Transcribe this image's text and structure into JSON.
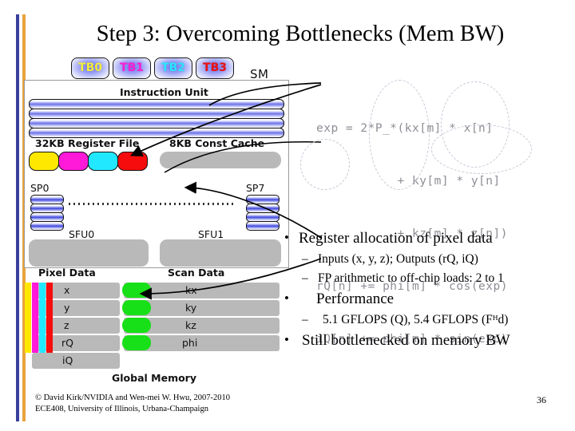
{
  "slide": {
    "title": "Step 3: Overcoming Bottlenecks (Mem BW)"
  },
  "diagram": {
    "sm_label": "SM",
    "thread_blocks": [
      {
        "label": "TB0",
        "color": "#f5ef3a"
      },
      {
        "label": "TB1",
        "color": "#ff1fd8"
      },
      {
        "label": "TB2",
        "color": "#2ae6ff"
      },
      {
        "label": "TB3",
        "color": "#ee1212"
      }
    ],
    "instruction_unit_label": "Instruction Unit",
    "register_file_label": "32KB Register File",
    "const_cache_label": "8KB Const Cache",
    "register_colors": [
      "#ffe800",
      "#ff19d8",
      "#22e8ff",
      "#f60c0c"
    ],
    "sp_left_label": "SP0",
    "sp_right_label": "SP7",
    "sfu0_label": "SFU0",
    "sfu1_label": "SFU1",
    "pixel_data_label": "Pixel Data",
    "scan_data_label": "Scan Data",
    "global_memory_label": "Global Memory",
    "pixel_data_rows": [
      "x",
      "y",
      "z",
      "rQ",
      "iQ"
    ],
    "scan_data_rows": [
      "kx",
      "ky",
      "kz",
      "phi"
    ]
  },
  "code": {
    "lines": [
      "exp = 2*P_*(kx[m] * x[n]",
      "           + ky[m] * y[n]",
      "           + kz[m] * z[n])",
      "rQ[n] += phi[m] * cos(exp)",
      "iQ[n] += phi[m] * sin(exp)"
    ]
  },
  "bullets": [
    {
      "level": 1,
      "text": "Register allocation of pixel data"
    },
    {
      "level": 2,
      "text": "Inputs (x, y, z); Outputs (rQ, iQ)"
    },
    {
      "level": 2,
      "text": "FP arithmetic to off-chip loads: 2 to 1"
    },
    {
      "level": 1,
      "text": "Performance"
    },
    {
      "level": 2,
      "text": "5.1 GFLOPS (Q), 5.4 GFLOPS (Fᴴd)"
    },
    {
      "level": 1,
      "text": "Still bottlenecked on memory BW"
    }
  ],
  "footer": {
    "line1": "© David Kirk/NVIDIA and Wen-mei W. Hwu, 2007-2010",
    "line2": "ECE408, University of Illinois, Urbana-Champaign",
    "page_number": "36"
  },
  "colors": {
    "accent_blue": "#3a3f9e",
    "accent_orange": "#e8a33d",
    "gray_block": "#b9b9b9",
    "green_block": "#18e018"
  }
}
